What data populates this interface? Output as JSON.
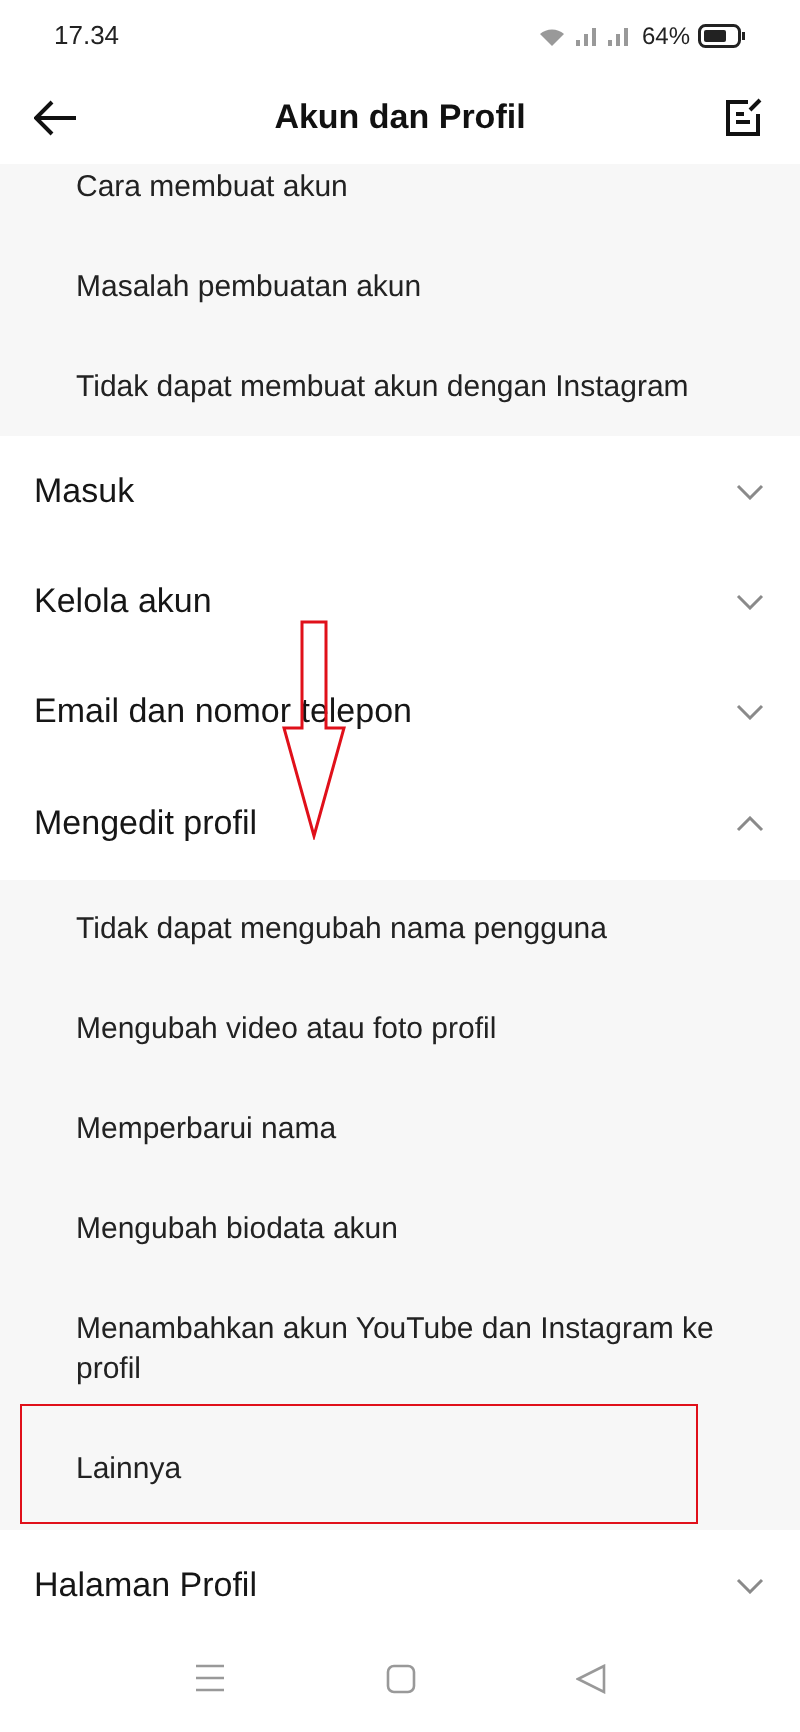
{
  "status_bar": {
    "time": "17.34",
    "battery": "64%"
  },
  "header": {
    "title": "Akun dan Profil"
  },
  "topics": [
    {
      "kind": "sublist",
      "items": [
        "Cara membuat akun",
        "Masalah pembuatan akun",
        "Tidak dapat membuat akun dengan Instagram"
      ]
    },
    {
      "kind": "section",
      "title": "Masuk",
      "expanded": false
    },
    {
      "kind": "section",
      "title": "Kelola akun",
      "expanded": false
    },
    {
      "kind": "section",
      "title": "Email dan nomor telepon",
      "expanded": false
    },
    {
      "kind": "section",
      "title": "Mengedit profil",
      "expanded": true,
      "items": [
        "Tidak dapat mengubah nama pengguna",
        "Mengubah video atau foto profil",
        "Memperbarui nama",
        "Mengubah biodata akun",
        "Menambahkan akun YouTube dan Instagram ke profil",
        "Lainnya"
      ]
    },
    {
      "kind": "section",
      "title": "Halaman Profil",
      "expanded": false
    }
  ]
}
